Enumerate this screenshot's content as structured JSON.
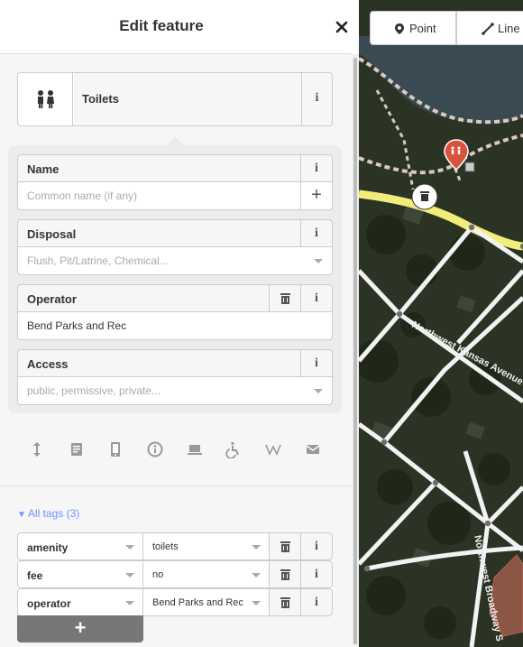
{
  "header": {
    "title": "Edit feature",
    "close_icon": "close-icon"
  },
  "preset": {
    "icon": "toilets-icon",
    "label": "Toilets"
  },
  "fields": [
    {
      "label": "Name",
      "value": "",
      "placeholder": "Common name (if any)",
      "type": "localized"
    },
    {
      "label": "Disposal",
      "value": "",
      "placeholder": "Flush, Pit/Latrine, Chemical...",
      "type": "combo"
    },
    {
      "label": "Operator",
      "value": "Bend Parks and Rec",
      "placeholder": "",
      "type": "text"
    },
    {
      "label": "Access",
      "value": "",
      "placeholder": "public, permissive, private...",
      "type": "combo"
    }
  ],
  "more_fields_icons": [
    "levels-icon",
    "description-icon",
    "phone-icon",
    "opening-hours-icon",
    "laptop-icon",
    "wheelchair-icon",
    "wikipedia-icon",
    "email-icon"
  ],
  "all_tags": {
    "label": "All tags (3)"
  },
  "tags": [
    {
      "key": "amenity",
      "value": "toilets"
    },
    {
      "key": "fee",
      "value": "no"
    },
    {
      "key": "operator",
      "value": "Bend Parks and Rec"
    }
  ],
  "add_tag": {
    "label": "+"
  },
  "map": {
    "modes": [
      {
        "label": "Point",
        "icon": "pin-icon"
      },
      {
        "label": "Line",
        "icon": "line-icon"
      }
    ],
    "street_labels": [
      "Northwest Kansas Avenue",
      "Northwest Broadway S"
    ],
    "colors": {
      "road": "#ffffff",
      "highlight_road": "#f2ec7a",
      "water": "#3a4a52",
      "grass": "#29331f",
      "building": "#b56552",
      "marker": "#d9523c"
    }
  }
}
